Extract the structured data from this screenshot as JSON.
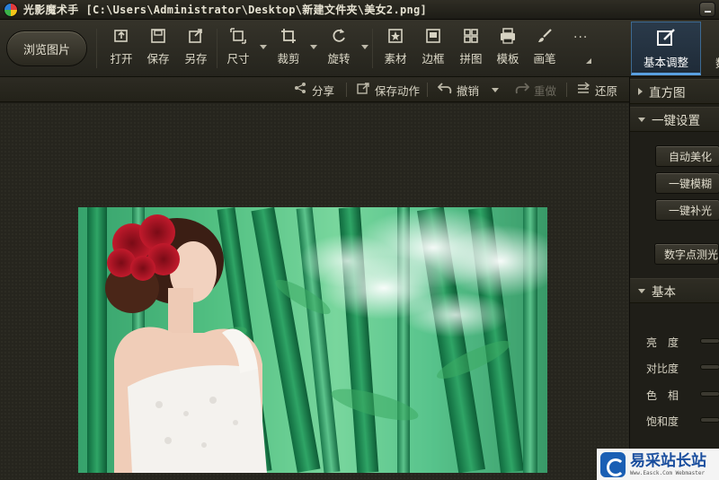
{
  "titlebar": {
    "app_name": "光影魔术手",
    "file_path": "[C:\\Users\\Administrator\\Desktop\\新建文件夹\\美女2.png]"
  },
  "toolbar": {
    "browse_label": "浏览图片",
    "tools": [
      {
        "label": "打开",
        "icon": "open-icon"
      },
      {
        "label": "保存",
        "icon": "save-icon"
      },
      {
        "label": "另存",
        "icon": "save-as-icon"
      },
      {
        "label": "尺寸",
        "icon": "resize-icon"
      },
      {
        "label": "裁剪",
        "icon": "crop-icon"
      },
      {
        "label": "旋转",
        "icon": "rotate-icon"
      },
      {
        "label": "素材",
        "icon": "material-icon"
      },
      {
        "label": "边框",
        "icon": "border-icon"
      },
      {
        "label": "拼图",
        "icon": "collage-icon"
      },
      {
        "label": "模板",
        "icon": "template-icon"
      },
      {
        "label": "画笔",
        "icon": "brush-icon"
      }
    ],
    "more_label": "···",
    "tabs": [
      {
        "label": "基本调整",
        "icon": "edit-icon",
        "active": true
      },
      {
        "label": "数",
        "icon": "next-tab-icon",
        "active": false
      }
    ]
  },
  "actionbar": {
    "share": "分享",
    "save_action": "保存动作",
    "undo": "撤销",
    "redo": "重做",
    "restore": "还原"
  },
  "panel": {
    "histogram": "直方图",
    "one_click": {
      "title": "一键设置",
      "buttons": [
        "自动美化",
        "一键模糊",
        "一键补光",
        "数字点测光"
      ]
    },
    "basic": {
      "title": "基本",
      "sliders": [
        "亮　度",
        "对比度",
        "色　相",
        "饱和度"
      ]
    }
  },
  "watermark": {
    "main": "易采站长站",
    "sub": "Www.Easck.Com Webmaster"
  },
  "colors": {
    "active_tab_border": "#5aa0e0",
    "background": "#1e1d17",
    "watermark_blue": "#1a4e9e"
  }
}
